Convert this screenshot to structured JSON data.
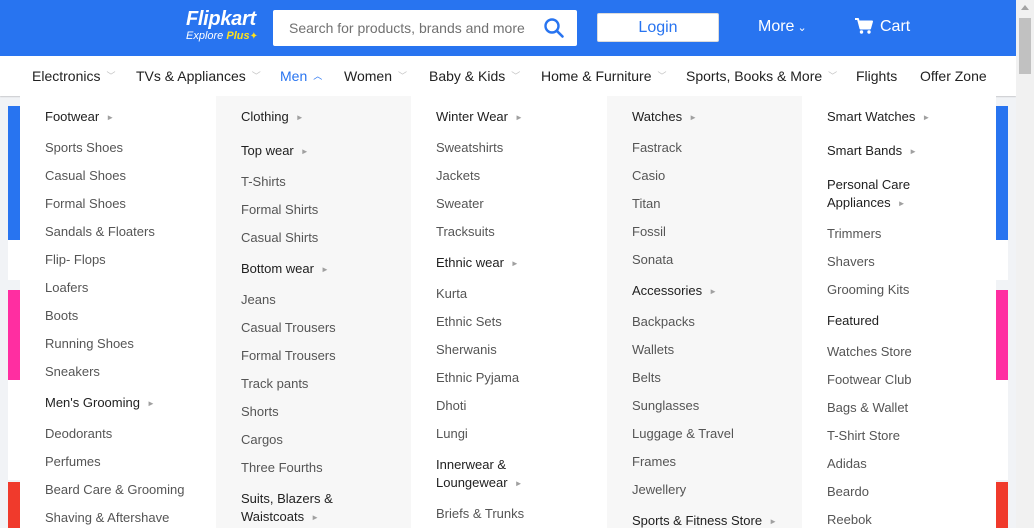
{
  "header": {
    "logo": "Flipkart",
    "tagline_explore": "Explore",
    "tagline_plus": "Plus",
    "search_placeholder": "Search for products, brands and more",
    "login_label": "Login",
    "more_label": "More",
    "cart_label": "Cart",
    "accent_color": "#2874f0",
    "plus_color": "#ffe11b"
  },
  "categories": [
    {
      "label": "Electronics",
      "has_chevron": true,
      "active": false
    },
    {
      "label": "TVs & Appliances",
      "has_chevron": true,
      "active": false
    },
    {
      "label": "Men",
      "has_chevron": true,
      "active": true
    },
    {
      "label": "Women",
      "has_chevron": true,
      "active": false
    },
    {
      "label": "Baby & Kids",
      "has_chevron": true,
      "active": false
    },
    {
      "label": "Home & Furniture",
      "has_chevron": true,
      "active": false
    },
    {
      "label": "Sports, Books & More",
      "has_chevron": true,
      "active": false
    },
    {
      "label": "Flights",
      "has_chevron": false,
      "active": false
    },
    {
      "label": "Offer Zone",
      "has_chevron": false,
      "active": false
    }
  ],
  "menu_columns": [
    [
      {
        "text": "Footwear",
        "type": "head",
        "arrow": true
      },
      {
        "text": "Sports Shoes",
        "type": "sub"
      },
      {
        "text": "Casual Shoes",
        "type": "sub"
      },
      {
        "text": "Formal Shoes",
        "type": "sub"
      },
      {
        "text": "Sandals & Floaters",
        "type": "sub"
      },
      {
        "text": "Flip- Flops",
        "type": "sub"
      },
      {
        "text": "Loafers",
        "type": "sub"
      },
      {
        "text": "Boots",
        "type": "sub"
      },
      {
        "text": "Running Shoes",
        "type": "sub"
      },
      {
        "text": "Sneakers",
        "type": "sub"
      },
      {
        "text": "Men's Grooming",
        "type": "head",
        "arrow": true
      },
      {
        "text": "Deodorants",
        "type": "sub"
      },
      {
        "text": "Perfumes",
        "type": "sub"
      },
      {
        "text": "Beard Care & Grooming",
        "type": "sub"
      },
      {
        "text": "Shaving & Aftershave",
        "type": "sub"
      }
    ],
    [
      {
        "text": "Clothing",
        "type": "head",
        "arrow": true
      },
      {
        "text": "Top wear",
        "type": "head",
        "arrow": true
      },
      {
        "text": "T-Shirts",
        "type": "sub"
      },
      {
        "text": "Formal Shirts",
        "type": "sub"
      },
      {
        "text": "Casual Shirts",
        "type": "sub"
      },
      {
        "text": "Bottom wear",
        "type": "head",
        "arrow": true
      },
      {
        "text": "Jeans",
        "type": "sub"
      },
      {
        "text": "Casual Trousers",
        "type": "sub"
      },
      {
        "text": "Formal Trousers",
        "type": "sub"
      },
      {
        "text": "Track pants",
        "type": "sub"
      },
      {
        "text": "Shorts",
        "type": "sub"
      },
      {
        "text": "Cargos",
        "type": "sub"
      },
      {
        "text": "Three Fourths",
        "type": "sub"
      },
      {
        "text": "Suits, Blazers &",
        "text2": "Waistcoats",
        "type": "head",
        "arrow": true
      }
    ],
    [
      {
        "text": "Winter Wear",
        "type": "head",
        "arrow": true
      },
      {
        "text": "Sweatshirts",
        "type": "sub"
      },
      {
        "text": "Jackets",
        "type": "sub"
      },
      {
        "text": "Sweater",
        "type": "sub"
      },
      {
        "text": "Tracksuits",
        "type": "sub"
      },
      {
        "text": "Ethnic wear",
        "type": "head",
        "arrow": true
      },
      {
        "text": "Kurta",
        "type": "sub"
      },
      {
        "text": "Ethnic Sets",
        "type": "sub"
      },
      {
        "text": "Sherwanis",
        "type": "sub"
      },
      {
        "text": "Ethnic Pyjama",
        "type": "sub"
      },
      {
        "text": "Dhoti",
        "type": "sub"
      },
      {
        "text": "Lungi",
        "type": "sub"
      },
      {
        "text": "Innerwear &",
        "text2": "Loungewear",
        "type": "head",
        "arrow": true
      },
      {
        "text": "Briefs & Trunks",
        "type": "sub"
      }
    ],
    [
      {
        "text": "Watches",
        "type": "head",
        "arrow": true
      },
      {
        "text": "Fastrack",
        "type": "sub"
      },
      {
        "text": "Casio",
        "type": "sub"
      },
      {
        "text": "Titan",
        "type": "sub"
      },
      {
        "text": "Fossil",
        "type": "sub"
      },
      {
        "text": "Sonata",
        "type": "sub"
      },
      {
        "text": "Accessories",
        "type": "head",
        "arrow": true
      },
      {
        "text": "Backpacks",
        "type": "sub"
      },
      {
        "text": "Wallets",
        "type": "sub"
      },
      {
        "text": "Belts",
        "type": "sub"
      },
      {
        "text": "Sunglasses",
        "type": "sub"
      },
      {
        "text": "Luggage & Travel",
        "type": "sub"
      },
      {
        "text": "Frames",
        "type": "sub"
      },
      {
        "text": "Jewellery",
        "type": "sub"
      },
      {
        "text": "Sports & Fitness Store",
        "type": "head",
        "arrow": true
      }
    ],
    [
      {
        "text": "Smart Watches",
        "type": "head",
        "arrow": true
      },
      {
        "text": "Smart Bands",
        "type": "head",
        "arrow": true
      },
      {
        "text": "Personal Care",
        "text2": "Appliances",
        "type": "head",
        "arrow": true
      },
      {
        "text": "Trimmers",
        "type": "sub"
      },
      {
        "text": "Shavers",
        "type": "sub"
      },
      {
        "text": "Grooming Kits",
        "type": "sub"
      },
      {
        "text": "Featured",
        "type": "head",
        "arrow": false
      },
      {
        "text": "Watches Store",
        "type": "sub"
      },
      {
        "text": "Footwear Club",
        "type": "sub"
      },
      {
        "text": "Bags & Wallet",
        "type": "sub"
      },
      {
        "text": "T-Shirt Store",
        "type": "sub"
      },
      {
        "text": "Adidas",
        "type": "sub"
      },
      {
        "text": "Beardo",
        "type": "sub"
      },
      {
        "text": "Reebok",
        "type": "sub"
      }
    ]
  ]
}
